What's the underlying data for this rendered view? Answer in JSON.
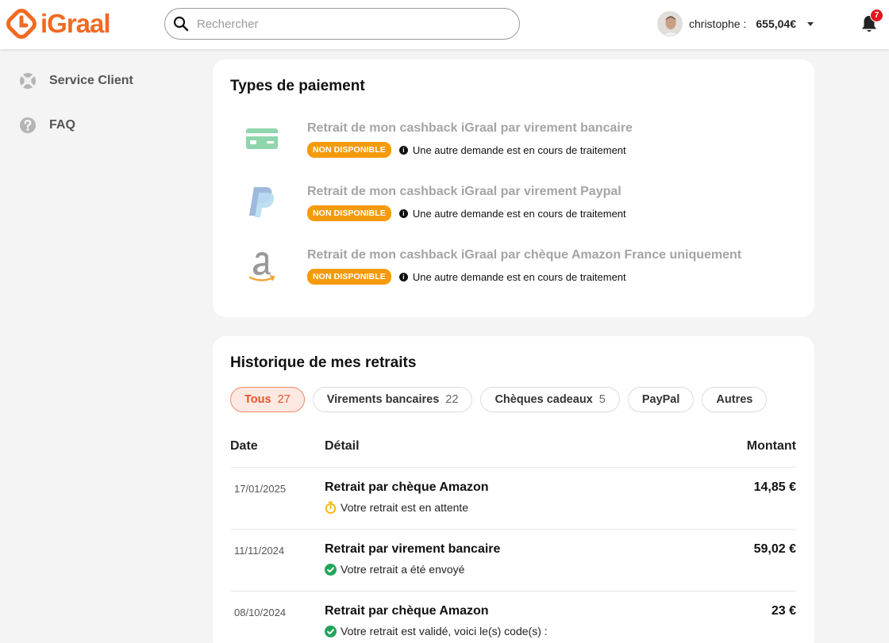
{
  "header": {
    "logo_text": "iGraal",
    "search_placeholder": "Rechercher",
    "user_name": "christophe :",
    "user_balance": "655,04€",
    "notification_count": "7"
  },
  "sidebar": {
    "items": [
      {
        "label": "Service Client",
        "icon": "lifebuoy-icon"
      },
      {
        "label": "FAQ",
        "icon": "question-icon"
      }
    ]
  },
  "payment_types": {
    "title": "Types de paiement",
    "items": [
      {
        "label": "Retrait de mon cashback iGraal par virement bancaire",
        "status": "NON DISPONIBLE",
        "message": "Une autre demande est en cours de traitement",
        "icon": "credit-card-icon"
      },
      {
        "label": "Retrait de mon cashback iGraal par virement Paypal",
        "status": "NON DISPONIBLE",
        "message": "Une autre demande est en cours de traitement",
        "icon": "paypal-icon"
      },
      {
        "label": "Retrait de mon cashback iGraal par chèque Amazon France uniquement",
        "status": "NON DISPONIBLE",
        "message": "Une autre demande est en cours de traitement",
        "icon": "amazon-icon"
      }
    ],
    "colors": {
      "badge": "#f59b0b",
      "card_icon": "#8fd6ad",
      "paypal_dark": "#9fb8dd",
      "paypal_light": "#b9dcf2"
    }
  },
  "history": {
    "title": "Historique de mes retraits",
    "filters": [
      {
        "label": "Tous",
        "count": "27",
        "active": true
      },
      {
        "label": "Virements bancaires",
        "count": "22",
        "active": false
      },
      {
        "label": "Chèques cadeaux",
        "count": "5",
        "active": false
      },
      {
        "label": "PayPal",
        "count": "",
        "active": false
      },
      {
        "label": "Autres",
        "count": "",
        "active": false
      }
    ],
    "columns": {
      "date": "Date",
      "detail": "Détail",
      "amount": "Montant"
    },
    "rows": [
      {
        "date": "17/01/2025",
        "title": "Retrait par chèque Amazon",
        "status": "Votre retrait est en attente",
        "status_icon": "timer-icon",
        "amount": "14,85 €"
      },
      {
        "date": "11/11/2024",
        "title": "Retrait par virement bancaire",
        "status": "Votre retrait a été envoyé",
        "status_icon": "check-circle-icon",
        "amount": "59,02 €"
      },
      {
        "date": "08/10/2024",
        "title": "Retrait par chèque Amazon",
        "status": "Votre retrait est validé, voici le(s) code(s) :",
        "status_icon": "check-circle-icon",
        "amount": "23 €"
      }
    ],
    "colors": {
      "active_chip_bg": "#fde9e2",
      "active_chip_text": "#e8542a",
      "success": "#22a55a",
      "pending": "#f2b400"
    }
  },
  "brand_color": "#f06a23"
}
